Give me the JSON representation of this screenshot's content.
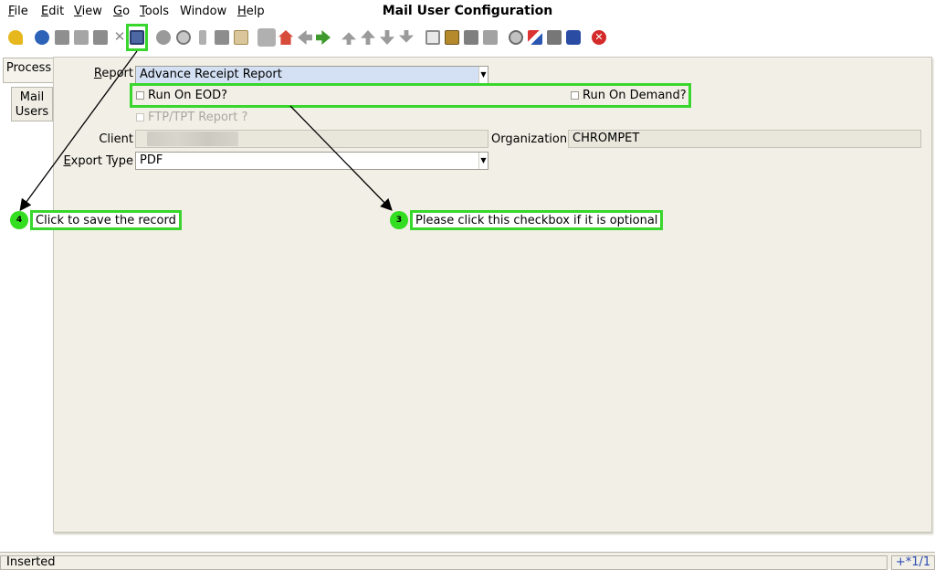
{
  "window": {
    "title": "Mail User Configuration"
  },
  "menu": [
    {
      "label": "File",
      "mnemonic": "F",
      "rest": "ile"
    },
    {
      "label": "Edit",
      "mnemonic": "E",
      "rest": "dit"
    },
    {
      "label": "View",
      "mnemonic": "V",
      "rest": "iew"
    },
    {
      "label": "Go",
      "mnemonic": "G",
      "rest": "o"
    },
    {
      "label": "Tools",
      "mnemonic": "T",
      "rest": "ools"
    },
    {
      "label": "Window",
      "mnemonic": "",
      "rest": "Window"
    },
    {
      "label": "Help",
      "mnemonic": "H",
      "rest": "elp"
    }
  ],
  "toolbar": {
    "icons": [
      "undo-icon",
      "help-icon",
      "new-icon",
      "copy-icon",
      "delete-icon",
      "delete-selection-icon",
      "save-icon",
      "refresh-icon",
      "find-icon",
      "attachment-icon",
      "chat-icon",
      "history-icon",
      "grid-toggle-icon",
      "home-icon",
      "back-icon",
      "forward-icon",
      "first-record-icon",
      "previous-record-icon",
      "next-record-icon",
      "last-record-icon",
      "report-icon",
      "archive-icon",
      "print-icon",
      "print-preview-icon",
      "zoom-across-icon",
      "workflow-icon",
      "product-info-icon",
      "request-icon",
      "exit-icon"
    ]
  },
  "tabs": {
    "process": "Process",
    "mail_users_line1": "Mail",
    "mail_users_line2": "Users"
  },
  "form": {
    "report_label_mn": "R",
    "report_label_rest": "eport",
    "report_value": "Advance Receipt Report",
    "run_on_eod": "Run On EOD?",
    "run_on_demand": "Run On Demand?",
    "ftp_report": "FTP/TPT Report ?",
    "client_label": "Client",
    "organization_label": "Organization",
    "organization_value": "CHROMPET",
    "export_label_mn": "E",
    "export_label_rest": "xport Type",
    "export_value": "PDF"
  },
  "annotations": {
    "step4_num": "4",
    "step4_text": "Click to save the record",
    "step3_num": "3",
    "step3_text": "Please click this checkbox if it is optional",
    "highlight_color": "#39d62e"
  },
  "status": {
    "left": "Inserted",
    "right": "+*1/1"
  }
}
